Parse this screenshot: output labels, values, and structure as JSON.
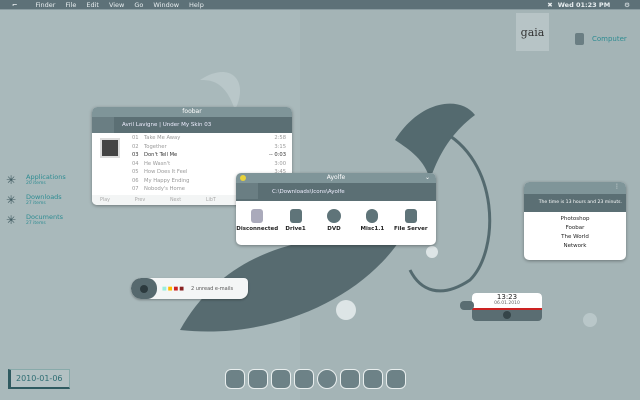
{
  "menubar": {
    "items": [
      "Finder",
      "File",
      "Edit",
      "View",
      "Go",
      "Window",
      "Help"
    ],
    "clock": "Wed 01:23 PM"
  },
  "desktop": {
    "computer_label": "Computer",
    "logo_text": "gaia"
  },
  "sidebar": [
    {
      "label": "Applications",
      "count": "20 items"
    },
    {
      "label": "Downloads",
      "count": "27 items"
    },
    {
      "label": "Documents",
      "count": "27 items"
    }
  ],
  "foobar": {
    "title": "foobar",
    "now_playing": "Avril Lavigne | Under My Skin   03",
    "tracks": [
      {
        "num": "01",
        "title": "Take Me Away",
        "time": "2:58"
      },
      {
        "num": "02",
        "title": "Together",
        "time": "3:15"
      },
      {
        "num": "03",
        "title": "Don't Tell Me",
        "time": "-- 0:03"
      },
      {
        "num": "04",
        "title": "He Wasn't",
        "time": "3:00"
      },
      {
        "num": "05",
        "title": "How Does It Feel",
        "time": "3:45"
      },
      {
        "num": "06",
        "title": "My Happy Ending",
        "time": ""
      },
      {
        "num": "07",
        "title": "Nobody's Home",
        "time": ""
      }
    ],
    "controls": [
      "Play",
      "Prev",
      "Next",
      "LibT",
      "Pref",
      "Tool"
    ]
  },
  "ayolfe": {
    "title": "Ayolfe",
    "path": "C:\\Downloads\\Icons\\Ayolfe",
    "icons": [
      "Disconnected",
      "Drive1",
      "DVD",
      "Misc1.1",
      "File Server"
    ]
  },
  "uptime": {
    "text": "The time is  13 hours and 23 minuts.",
    "items": [
      "Photoshop",
      "Foobar",
      "The World",
      "Network"
    ]
  },
  "mail": {
    "text": "2 unread e-mails"
  },
  "clock_widget": {
    "time": "13:23",
    "date": "06.01.2010"
  },
  "date_box": "2010-01-06",
  "dock": [
    "leaf",
    "corner",
    "clover",
    "leaf-dot",
    "disc",
    "window",
    "shield",
    "drive"
  ],
  "colors": {
    "accent": "#2e8c92",
    "bar": "#5d7178",
    "background": "#a9b9bb"
  }
}
